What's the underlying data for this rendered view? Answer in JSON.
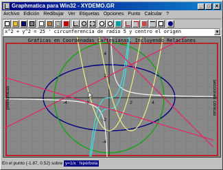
{
  "window": {
    "title": "Graphmatica para Win32 - XYDEMO.GR",
    "min_glyph": "_",
    "max_glyph": "□",
    "close_glyph": "✕"
  },
  "menu": [
    "Archivo",
    "Edición",
    "Redibujar",
    "Ver",
    "Etiquetas",
    "Opciones",
    "Punto",
    "Calcular",
    "?"
  ],
  "toolbar": {
    "buttons": [
      "new-icon",
      "open-icon",
      "save-icon",
      "print-icon",
      "copy-icon",
      "paste-icon",
      "grid-icon",
      "settings-icon",
      "cartesian-icon",
      "polar-icon",
      "zoom-box-icon",
      "zoom-in-icon",
      "zoom-out-icon",
      "redraw-icon",
      "trace-icon",
      "derivative-icon",
      "integral-icon",
      "tangent-icon",
      "table-icon",
      "help-icon"
    ]
  },
  "equation": {
    "value": "x^2 + y^2 = 25 ' circunferencia de radio 5 y centro el origen",
    "dropdown_glyph": "▼"
  },
  "graph": {
    "title": "Gráficas en Coordenadas Cartesianas, Incluyendo Relaciones",
    "left_label": "polinómicas",
    "right_label": "secciones cónicas",
    "x_ticks": [
      "-4",
      "-2",
      "2",
      "4"
    ],
    "y_ticks": [
      "4",
      "2",
      "-2",
      "-4"
    ],
    "colors": {
      "background": "#888888",
      "frame": "#cc0000",
      "ellipse": "#000080",
      "circle": "#00aa00",
      "hyperbola": "#f8f8f8",
      "cubic": "#40e0e0",
      "parabola": "#f0f080",
      "lines": "#e8206a"
    }
  },
  "status": {
    "point_label": "En el punto (-1.87, 0.52) sobre",
    "function_label": "y=1/x ' hipérbola"
  }
}
